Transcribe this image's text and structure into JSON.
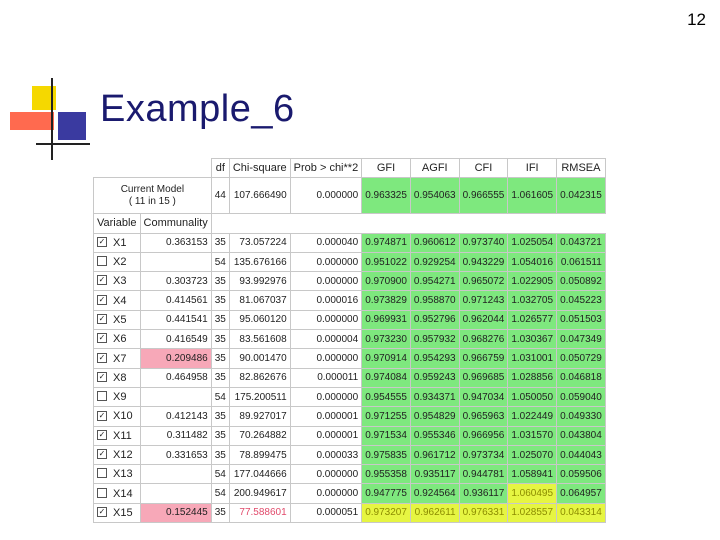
{
  "slide": {
    "page_number": "12",
    "title": "Example_6"
  },
  "table": {
    "headers": [
      "df",
      "Chi-square",
      "Prob > chi**2",
      "GFI",
      "AGFI",
      "CFI",
      "IFI",
      "RMSEA"
    ],
    "current_model": {
      "label_line1": "Current Model",
      "label_line2": "( 11 in 15 )",
      "values": [
        "44",
        "107.666490",
        "0.000000",
        "0.963325",
        "0.954063",
        "0.966555",
        "1.061605",
        "0.042315"
      ]
    },
    "subheaders": {
      "variable": "Variable",
      "communality": "Communality"
    },
    "rows": [
      {
        "checked": true,
        "var": "X1",
        "comm": "0.363153",
        "df": "35",
        "chi": "73.057224",
        "prob": "0.000040",
        "gfi": "0.974871",
        "agfi": "0.960612",
        "cfi": "0.973740",
        "ifi": "1.025054",
        "rmsea": "0.043721"
      },
      {
        "checked": false,
        "var": "X2",
        "comm": "",
        "df": "54",
        "chi": "135.676166",
        "prob": "0.000000",
        "gfi": "0.951022",
        "agfi": "0.929254",
        "cfi": "0.943229",
        "ifi": "1.054016",
        "rmsea": "0.061511"
      },
      {
        "checked": true,
        "var": "X3",
        "comm": "0.303723",
        "df": "35",
        "chi": "93.992976",
        "prob": "0.000000",
        "gfi": "0.970900",
        "agfi": "0.954271",
        "cfi": "0.965072",
        "ifi": "1.022905",
        "rmsea": "0.050892"
      },
      {
        "checked": true,
        "var": "X4",
        "comm": "0.414561",
        "df": "35",
        "chi": "81.067037",
        "prob": "0.000016",
        "gfi": "0.973829",
        "agfi": "0.958870",
        "cfi": "0.971243",
        "ifi": "1.032705",
        "rmsea": "0.045223"
      },
      {
        "checked": true,
        "var": "X5",
        "comm": "0.441541",
        "df": "35",
        "chi": "95.060120",
        "prob": "0.000000",
        "gfi": "0.969931",
        "agfi": "0.952796",
        "cfi": "0.962044",
        "ifi": "1.026577",
        "rmsea": "0.051503"
      },
      {
        "checked": true,
        "var": "X6",
        "comm": "0.416549",
        "df": "35",
        "chi": "83.561608",
        "prob": "0.000004",
        "gfi": "0.973230",
        "agfi": "0.957932",
        "cfi": "0.968276",
        "ifi": "1.030367",
        "rmsea": "0.047349"
      },
      {
        "checked": true,
        "var": "X7",
        "comm": "0.209486",
        "df": "35",
        "chi": "90.001470",
        "prob": "0.000000",
        "gfi": "0.970914",
        "agfi": "0.954293",
        "cfi": "0.966759",
        "ifi": "1.031001",
        "rmsea": "0.050729"
      },
      {
        "checked": true,
        "var": "X8",
        "comm": "0.464958",
        "df": "35",
        "chi": "82.862676",
        "prob": "0.000011",
        "gfi": "0.974084",
        "agfi": "0.959243",
        "cfi": "0.969685",
        "ifi": "1.028856",
        "rmsea": "0.046818"
      },
      {
        "checked": false,
        "var": "X9",
        "comm": "",
        "df": "54",
        "chi": "175.200511",
        "prob": "0.000000",
        "gfi": "0.954555",
        "agfi": "0.934371",
        "cfi": "0.947034",
        "ifi": "1.050050",
        "rmsea": "0.059040"
      },
      {
        "checked": true,
        "var": "X10",
        "comm": "0.412143",
        "df": "35",
        "chi": "89.927017",
        "prob": "0.000001",
        "gfi": "0.971255",
        "agfi": "0.954829",
        "cfi": "0.965963",
        "ifi": "1.022449",
        "rmsea": "0.049330"
      },
      {
        "checked": true,
        "var": "X11",
        "comm": "0.311482",
        "df": "35",
        "chi": "70.264882",
        "prob": "0.000001",
        "gfi": "0.971534",
        "agfi": "0.955346",
        "cfi": "0.966956",
        "ifi": "1.031570",
        "rmsea": "0.043804"
      },
      {
        "checked": true,
        "var": "X12",
        "comm": "0.331653",
        "df": "35",
        "chi": "78.899475",
        "prob": "0.000033",
        "gfi": "0.975835",
        "agfi": "0.961712",
        "cfi": "0.973734",
        "ifi": "1.025070",
        "rmsea": "0.044043"
      },
      {
        "checked": false,
        "var": "X13",
        "comm": "",
        "df": "54",
        "chi": "177.044666",
        "prob": "0.000000",
        "gfi": "0.955358",
        "agfi": "0.935117",
        "cfi": "0.944781",
        "ifi": "1.058941",
        "rmsea": "0.059506"
      },
      {
        "checked": false,
        "var": "X14",
        "comm": "",
        "df": "54",
        "chi": "200.949617",
        "prob": "0.000000",
        "gfi": "0.947775",
        "agfi": "0.924564",
        "cfi": "0.936117",
        "ifi": "1.060495",
        "rmsea": "0.064957"
      },
      {
        "checked": true,
        "var": "X15",
        "comm": "0.152445",
        "df": "35",
        "chi": "77.588601",
        "prob": "0.000051",
        "gfi": "0.973207",
        "agfi": "0.962611",
        "cfi": "0.976331",
        "ifi": "1.028557",
        "rmsea": "0.043314"
      }
    ]
  },
  "colors": {
    "green": "#7ee87e",
    "yellow": "#e6f542",
    "pink": "#f7a8b8",
    "title": "#1a1a6e"
  }
}
